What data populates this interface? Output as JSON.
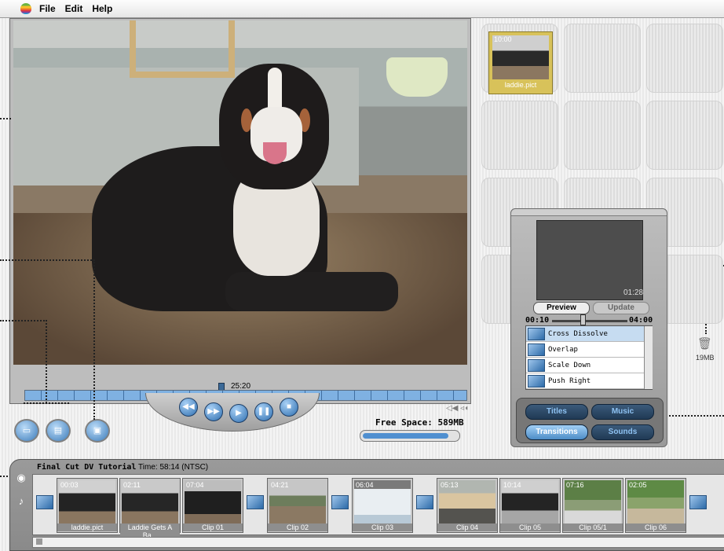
{
  "menu": {
    "items": [
      "File",
      "Edit",
      "Help"
    ]
  },
  "viewer": {
    "timecode": "25:20",
    "playhead_fraction": 0.44
  },
  "transport": {
    "rewind_icon": "rewind-icon",
    "ffwd_icon": "fast-forward-icon",
    "play_icon": "play-icon",
    "pause_icon": "pause-icon",
    "stop_icon": "stop-icon",
    "volume_icon": "speaker-icon"
  },
  "freespace": {
    "label": "Free Space: 589MB",
    "fill_fraction": 0.92
  },
  "shelf": {
    "clip": {
      "timecode": "10:00",
      "name": "laddie.pict"
    },
    "trash_size": "19MB"
  },
  "effects": {
    "preview_time": "01:28",
    "preview_label": "Preview",
    "update_label": "Update",
    "start": "00:10",
    "end": "04:00",
    "slider_fraction": 0.4,
    "list": [
      {
        "name": "Cross Dissolve",
        "selected": true
      },
      {
        "name": "Overlap",
        "selected": false
      },
      {
        "name": "Scale Down",
        "selected": false
      },
      {
        "name": "Push Right",
        "selected": false
      }
    ],
    "tabs": [
      {
        "label": "Titles",
        "active": false
      },
      {
        "label": "Music",
        "active": false
      },
      {
        "label": "Transitions",
        "active": true
      },
      {
        "label": "Sounds",
        "active": false
      }
    ]
  },
  "timeline": {
    "title": "Final Cut DV Tutorial",
    "time_label": "Time: 58:14 (NTSC)",
    "clips": [
      {
        "timecode": "00:03",
        "name": "laddie.pict"
      },
      {
        "timecode": "02:11",
        "name": "Laddie Gets A Ba..."
      },
      {
        "timecode": "07:04",
        "name": "Clip 01"
      },
      {
        "timecode": "04:21",
        "name": "Clip 02"
      },
      {
        "timecode": "06:04",
        "name": "Clip 03"
      },
      {
        "timecode": "05:13",
        "name": "Clip 04"
      },
      {
        "timecode": "10:14",
        "name": "Clip 05"
      },
      {
        "timecode": "07:16",
        "name": "Clip 05/1"
      },
      {
        "timecode": "02:05",
        "name": "Clip 06"
      }
    ]
  },
  "colors": {
    "accent": "#4f8fd0",
    "selection": "#c6dcf1",
    "shelf_clip": "#d8c25a"
  }
}
